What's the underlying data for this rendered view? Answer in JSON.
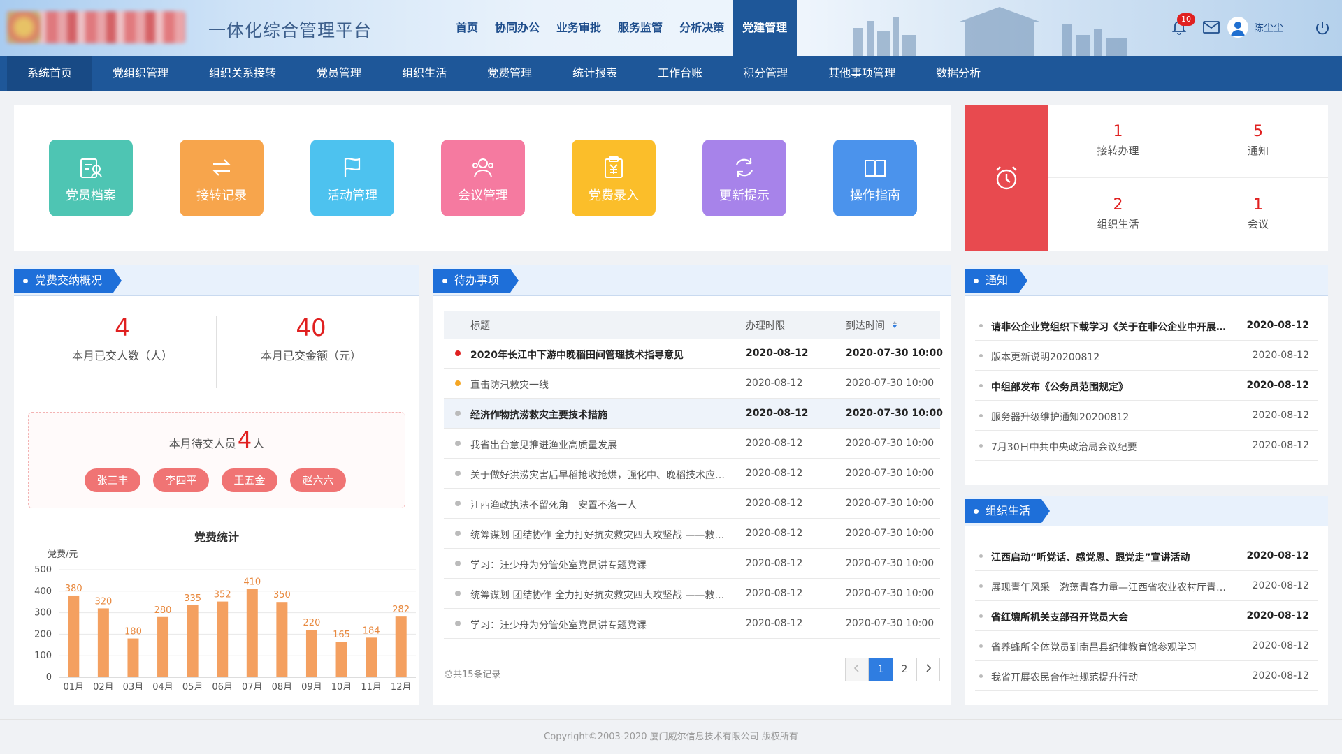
{
  "header": {
    "platform_title": "一体化综合管理平台",
    "nav": [
      "首页",
      "协同办公",
      "业务审批",
      "服务监管",
      "分析决策",
      "党建管理"
    ],
    "active_nav": 5,
    "notification_count": "10",
    "username": "陈尘尘"
  },
  "subnav": [
    "系统首页",
    "党组织管理",
    "组织关系接转",
    "党员管理",
    "组织生活",
    "党费管理",
    "统计报表",
    "工作台账",
    "积分管理",
    "其他事项管理",
    "数据分析"
  ],
  "quick_actions": [
    {
      "label": "党员档案",
      "color": "#4ec5b3",
      "icon": "member-file-icon"
    },
    {
      "label": "接转记录",
      "color": "#f7a54c",
      "icon": "transfer-icon"
    },
    {
      "label": "活动管理",
      "color": "#4dc2ef",
      "icon": "flag-icon"
    },
    {
      "label": "会议管理",
      "color": "#f57aa0",
      "icon": "meeting-icon"
    },
    {
      "label": "党费录入",
      "color": "#fbbe2a",
      "icon": "fee-entry-icon"
    },
    {
      "label": "更新提示",
      "color": "#a783ea",
      "icon": "refresh-icon"
    },
    {
      "label": "操作指南",
      "color": "#4b93ec",
      "icon": "book-icon"
    }
  ],
  "todo_summary": [
    {
      "count": "1",
      "label": "接转办理"
    },
    {
      "count": "5",
      "label": "通知"
    },
    {
      "count": "2",
      "label": "组织生活"
    },
    {
      "count": "1",
      "label": "会议"
    }
  ],
  "fee": {
    "title": "党费交纳概况",
    "paid_count": "4",
    "paid_count_label": "本月已交人数（人）",
    "paid_amount": "40",
    "paid_amount_label": "本月已交金额（元）",
    "pending_prefix": "本月待交人员",
    "pending_count": "4",
    "pending_suffix": "人",
    "pending_people": [
      "张三丰",
      "李四平",
      "王五金",
      "赵六六"
    ]
  },
  "chart_data": {
    "type": "bar",
    "title": "党费统计",
    "ylabel": "党费/元",
    "categories": [
      "01月",
      "02月",
      "03月",
      "04月",
      "05月",
      "06月",
      "07月",
      "08月",
      "09月",
      "10月",
      "11月",
      "12月"
    ],
    "values": [
      380,
      320,
      180,
      280,
      335,
      352,
      410,
      350,
      220,
      165,
      184,
      282
    ],
    "yticks": [
      0,
      100,
      200,
      300,
      400,
      500
    ],
    "ylim": [
      0,
      500
    ],
    "color": "#f4a060",
    "label_color": "#e8893f"
  },
  "tasks": {
    "title": "待办事项",
    "headers": {
      "title": "标题",
      "deadline": "办理时限",
      "arrival": "到达时间"
    },
    "rows": [
      {
        "title": "2020年长江中下游中晚稻田间管理技术指导意见",
        "deadline": "2020-08-12",
        "arrival": "2020-07-30 10:00",
        "dot": "#e02020",
        "bold": true
      },
      {
        "title": "直击防汛救灾一线",
        "deadline": "2020-08-12",
        "arrival": "2020-07-30 10:00",
        "dot": "#f5a623",
        "bold": false
      },
      {
        "title": "经济作物抗涝救灾主要技术措施",
        "deadline": "2020-08-12",
        "arrival": "2020-07-30 10:00",
        "dot": "#bbbbbb",
        "bold": true,
        "highlight": true
      },
      {
        "title": "我省出台意见推进渔业高质量发展",
        "deadline": "2020-08-12",
        "arrival": "2020-07-30 10:00",
        "dot": "#bbbbbb",
        "bold": false
      },
      {
        "title": "关于做好洪涝灾害后早稻抢收抢烘，强化中、晚稻技术应对的通知",
        "deadline": "2020-08-12",
        "arrival": "2020-07-30 10:00",
        "dot": "#bbbbbb",
        "bold": false
      },
      {
        "title": "江西渔政执法不留死角　安置不落一人",
        "deadline": "2020-08-12",
        "arrival": "2020-07-30 10:00",
        "dot": "#bbbbbb",
        "bold": false
      },
      {
        "title": "统筹谋划 团结协作 全力打好抗灾救灾四大攻坚战 ——救灾物资保障",
        "deadline": "2020-08-12",
        "arrival": "2020-07-30 10:00",
        "dot": "#bbbbbb",
        "bold": false
      },
      {
        "title": "学习：汪少舟为分管处室党员讲专题党课",
        "deadline": "2020-08-12",
        "arrival": "2020-07-30 10:00",
        "dot": "#bbbbbb",
        "bold": false
      },
      {
        "title": "统筹谋划 团结协作 全力打好抗灾救灾四大攻坚战 ——救灾物资保障",
        "deadline": "2020-08-12",
        "arrival": "2020-07-30 10:00",
        "dot": "#bbbbbb",
        "bold": false
      },
      {
        "title": "学习：汪少舟为分管处室党员讲专题党课",
        "deadline": "2020-08-12",
        "arrival": "2020-07-30 10:00",
        "dot": "#bbbbbb",
        "bold": false
      }
    ],
    "total_text": "总共15条记录",
    "pages": [
      "1",
      "2"
    ],
    "current_page": "1"
  },
  "notices": {
    "title": "通知",
    "rows": [
      {
        "title": "请非公企业党组织下载学习《关于在非公企业中开展党员教育工作的通知》",
        "date": "2020-08-12",
        "bold": true
      },
      {
        "title": "版本更新说明20200812",
        "date": "2020-08-12",
        "bold": false
      },
      {
        "title": "中组部发布《公务员范围规定》",
        "date": "2020-08-12",
        "bold": true
      },
      {
        "title": "服务器升级维护通知20200812",
        "date": "2020-08-12",
        "bold": false
      },
      {
        "title": "7月30日中共中央政治局会议纪要",
        "date": "2020-08-12",
        "bold": false
      }
    ]
  },
  "org_life": {
    "title": "组织生活",
    "rows": [
      {
        "title": "江西启动“听党话、感党恩、跟党走”宣讲活动",
        "date": "2020-08-12",
        "bold": true
      },
      {
        "title": "展现青年风采　激荡青春力量—江西省农业农村厅青年干部座谈会",
        "date": "2020-08-12",
        "bold": false
      },
      {
        "title": "省红壤所机关支部召开党员大会",
        "date": "2020-08-12",
        "bold": true
      },
      {
        "title": "省养蜂所全体党员到南昌县纪律教育馆参观学习",
        "date": "2020-08-12",
        "bold": false
      },
      {
        "title": "我省开展农民合作社规范提升行动",
        "date": "2020-08-12",
        "bold": false
      }
    ]
  },
  "footer": "Copyright©2003-2020 厦门威尔信息技术有限公司 版权所有"
}
